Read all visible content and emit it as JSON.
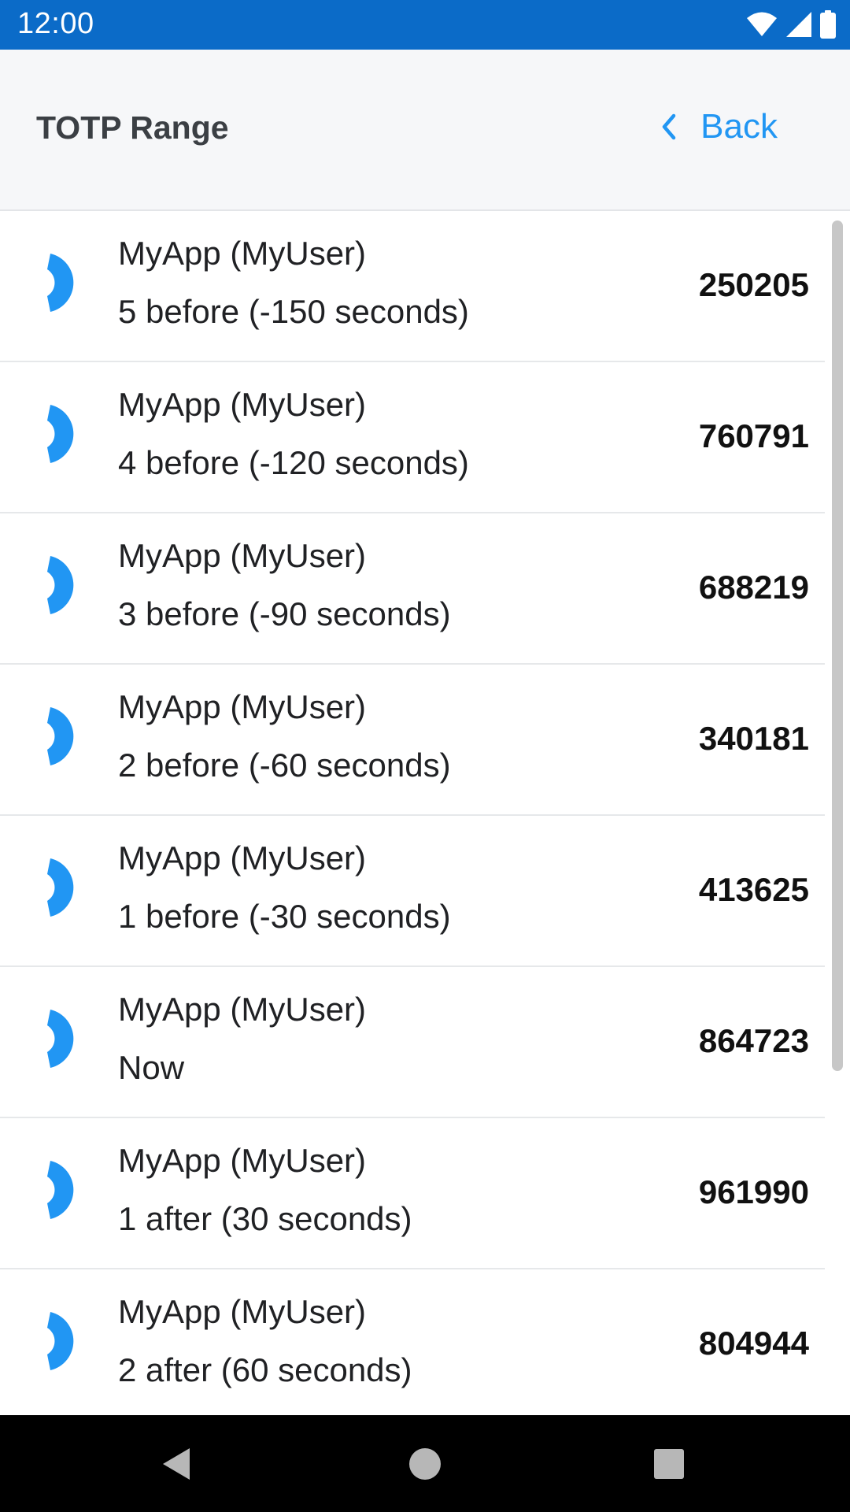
{
  "status_bar": {
    "time": "12:00"
  },
  "header": {
    "title": "TOTP Range",
    "back_label": "Back"
  },
  "accent_color": "#2196f3",
  "status_bar_color": "#0b6bc8",
  "items": [
    {
      "title": "MyApp (MyUser)",
      "subtitle": "5 before (-150 seconds)",
      "code": "250205"
    },
    {
      "title": "MyApp (MyUser)",
      "subtitle": "4 before (-120 seconds)",
      "code": "760791"
    },
    {
      "title": "MyApp (MyUser)",
      "subtitle": "3 before (-90 seconds)",
      "code": "688219"
    },
    {
      "title": "MyApp (MyUser)",
      "subtitle": "2 before (-60 seconds)",
      "code": "340181"
    },
    {
      "title": "MyApp (MyUser)",
      "subtitle": "1 before (-30 seconds)",
      "code": "413625"
    },
    {
      "title": "MyApp (MyUser)",
      "subtitle": "Now",
      "code": "864723"
    },
    {
      "title": "MyApp (MyUser)",
      "subtitle": "1 after (30 seconds)",
      "code": "961990"
    },
    {
      "title": "MyApp (MyUser)",
      "subtitle": "2 after (60 seconds)",
      "code": "804944"
    }
  ],
  "icons": {
    "wifi": "wifi-icon",
    "signal": "signal-icon",
    "battery": "battery-icon",
    "back": "chevron-left-icon",
    "timer": "countdown-arc-icon",
    "nav_back": "triangle-back-icon",
    "nav_home": "circle-home-icon",
    "nav_recents": "square-recents-icon"
  }
}
